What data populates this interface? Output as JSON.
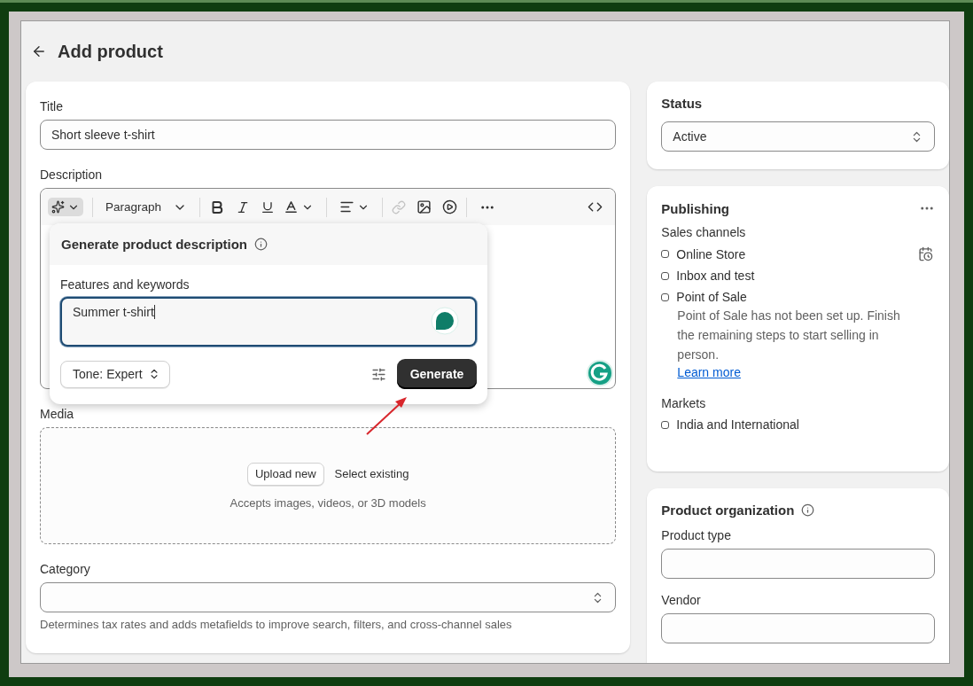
{
  "page": {
    "title": "Add product"
  },
  "product_form": {
    "title_field": {
      "label": "Title",
      "value": "Short sleeve t-shirt"
    },
    "description": {
      "label": "Description",
      "paragraph_style": "Paragraph"
    },
    "generate_popover": {
      "title": "Generate product description",
      "field_label": "Features and keywords",
      "value": "Summer t-shirt",
      "tone": "Tone: Expert",
      "button": "Generate"
    },
    "media": {
      "label": "Media",
      "upload_button": "Upload new",
      "select_link": "Select existing",
      "hint": "Accepts images, videos, or 3D models"
    },
    "category": {
      "label": "Category",
      "help": "Determines tax rates and adds metafields to improve search, filters, and cross-channel sales"
    }
  },
  "status": {
    "label": "Status",
    "value": "Active"
  },
  "publishing": {
    "title": "Publishing",
    "sales_channels_label": "Sales channels",
    "channels": [
      {
        "name": "Online Store",
        "checked": false
      },
      {
        "name": "Inbox and test",
        "checked": false
      },
      {
        "name": "Point of Sale",
        "checked": false,
        "note": "Point of Sale has not been set up. Finish the remaining steps to start selling in person.",
        "link": "Learn more"
      }
    ],
    "markets_label": "Markets",
    "markets": [
      {
        "name": "India and International",
        "checked": false
      }
    ]
  },
  "organization": {
    "title": "Product organization",
    "fields": [
      {
        "label": "Product type"
      },
      {
        "label": "Vendor"
      }
    ]
  }
}
